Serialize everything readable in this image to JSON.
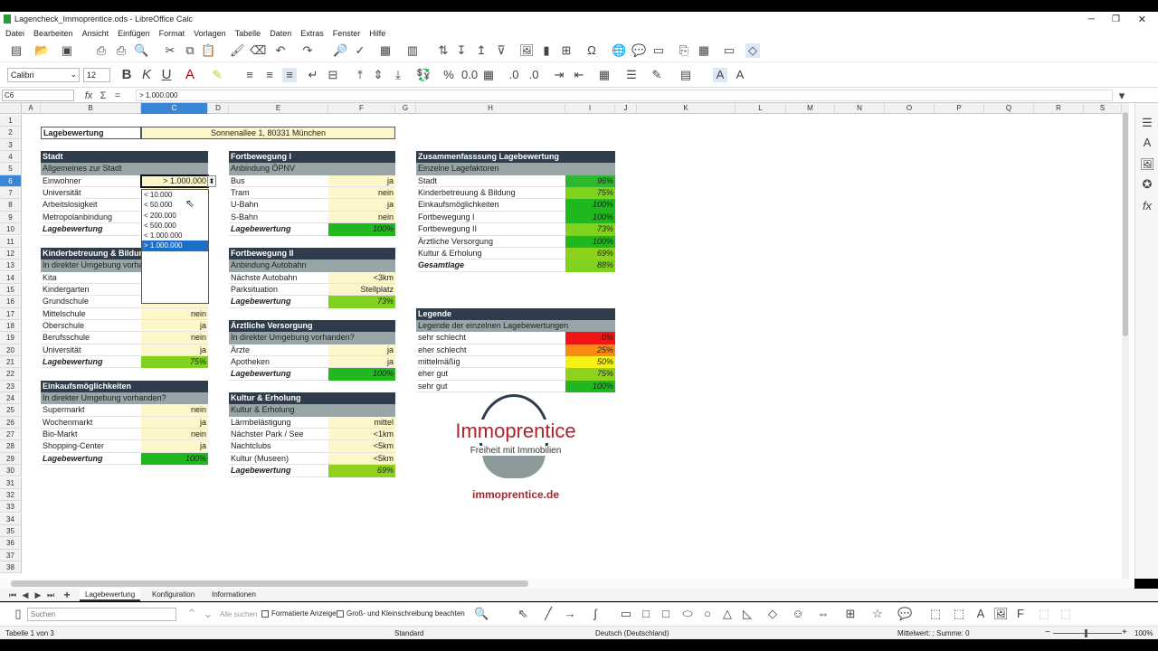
{
  "app": {
    "title": "Lagencheck_Immoprentice.ods - LibreOffice Calc"
  },
  "menu": [
    "Datei",
    "Bearbeiten",
    "Ansicht",
    "Einfügen",
    "Format",
    "Vorlagen",
    "Tabelle",
    "Daten",
    "Extras",
    "Fenster",
    "Hilfe"
  ],
  "formatbar": {
    "font": "Calibri",
    "size": "12"
  },
  "formulabar": {
    "cellref": "C6",
    "content": "> 1.000.000"
  },
  "columns": [
    "A",
    "B",
    "C",
    "D",
    "E",
    "F",
    "G",
    "H",
    "I",
    "J",
    "K",
    "L",
    "M",
    "N",
    "O",
    "P",
    "Q",
    "R",
    "S"
  ],
  "rows": [
    "1",
    "2",
    "3",
    "4",
    "5",
    "6",
    "7",
    "8",
    "9",
    "10",
    "11",
    "12",
    "13",
    "14",
    "15",
    "16",
    "17",
    "18",
    "19",
    "20",
    "21",
    "22",
    "23",
    "24",
    "25",
    "26",
    "27",
    "28",
    "29",
    "30",
    "31",
    "32",
    "33",
    "34",
    "35",
    "36",
    "37",
    "38"
  ],
  "sheet": {
    "title_label": "Lagebewertung",
    "address": "Sonnenallee 1, 80331 München",
    "stadt": {
      "header": "Stadt",
      "sub": "Allgemeines zur Stadt",
      "rows": [
        [
          "Einwohner",
          "> 1.000.000"
        ],
        [
          "Universität",
          ""
        ],
        [
          "Arbeitslosigkeit",
          ""
        ],
        [
          "Metropolanbindung",
          ""
        ]
      ],
      "total_label": "Lagebewertung"
    },
    "kinder": {
      "header": "Kinderbetreuung & Bildung",
      "sub": "In direkter Umgebung vorhanden?",
      "rows": [
        [
          "Kita",
          ""
        ],
        [
          "Kindergarten",
          ""
        ],
        [
          "Grundschule",
          ""
        ],
        [
          "Mittelschule",
          "nein"
        ],
        [
          "Oberschule",
          "ja"
        ],
        [
          "Berufsschule",
          "nein"
        ],
        [
          "Universität",
          "ja"
        ]
      ],
      "total_label": "Lagebewertung",
      "total": "75%"
    },
    "einkauf": {
      "header": "Einkaufsmöglichkeiten",
      "sub": "In direkter Umgebung vorhanden?",
      "rows": [
        [
          "Supermarkt",
          "nein"
        ],
        [
          "Wochenmarkt",
          "ja"
        ],
        [
          "Bio-Markt",
          "nein"
        ],
        [
          "Shopping-Center",
          "ja"
        ]
      ],
      "total_label": "Lagebewertung",
      "total": "100%"
    },
    "fort1": {
      "header": "Fortbewegung I",
      "sub": "Anbindung ÖPNV",
      "rows": [
        [
          "Bus",
          "ja"
        ],
        [
          "Tram",
          "nein"
        ],
        [
          "U-Bahn",
          "ja"
        ],
        [
          "S-Bahn",
          "nein"
        ]
      ],
      "total_label": "Lagebewertung",
      "total": "100%"
    },
    "fort2": {
      "header": "Fortbewegung II",
      "sub": "Anbindung Autobahn",
      "rows": [
        [
          "Nächste Autobahn",
          "<3km"
        ],
        [
          "Parksituation",
          "Stellplatz"
        ]
      ],
      "total_label": "Lagebewertung",
      "total": "73%"
    },
    "arzt": {
      "header": "Ärztliche Versorgung",
      "sub": "In direkter Umgebung vorhanden?",
      "rows": [
        [
          "Ärzte",
          "ja"
        ],
        [
          "Apotheken",
          "ja"
        ]
      ],
      "total_label": "Lagebewertung",
      "total": "100%"
    },
    "kultur": {
      "header": "Kultur & Erholung",
      "sub": "Kultur & Erholung",
      "rows": [
        [
          "Lärmbelästigung",
          "mittel"
        ],
        [
          "Nächster Park / See",
          "<1km"
        ],
        [
          "Nachtclubs",
          "<5km"
        ],
        [
          "Kultur (Museen)",
          "<5km"
        ]
      ],
      "total_label": "Lagebewertung",
      "total": "69%"
    },
    "zusammen": {
      "header": "Zusammenfasssung Lagebewertung",
      "sub": "Einzelne Lagefaktoren",
      "rows": [
        [
          "Stadt",
          "96%",
          "#2db82d"
        ],
        [
          "Kinderbetreuung & Bildung",
          "75%",
          "#7fd21e"
        ],
        [
          "Einkaufsmöglichkeiten",
          "100%",
          "#1fb81f"
        ],
        [
          "Fortbewegung I",
          "100%",
          "#1fb81f"
        ],
        [
          "Fortbewegung II",
          "73%",
          "#7fd21e"
        ],
        [
          "Ärztliche Versorgung",
          "100%",
          "#1fb81f"
        ],
        [
          "Kultur & Erholung",
          "69%",
          "#8fd21e"
        ]
      ],
      "total_label": "Gesamtlage",
      "total": "88%"
    },
    "legende": {
      "header": "Legende",
      "sub": "Legende der einzelnen Lagebewertungen",
      "rows": [
        [
          "sehr schlecht",
          "0%",
          "#f01414"
        ],
        [
          "eher schlecht",
          "25%",
          "#f78b14"
        ],
        [
          "mittelmäßig",
          "50%",
          "#f6f014"
        ],
        [
          "eher gut",
          "75%",
          "#8fd21e"
        ],
        [
          "sehr gut",
          "100%",
          "#1fb81f"
        ]
      ]
    },
    "logo": {
      "name": "Immoprentice",
      "tagline": "Freiheit mit Immobilien",
      "url": "immoprentice.de"
    }
  },
  "dropdown": {
    "options": [
      "< 10.000",
      "< 50.000",
      "< 200.000",
      "< 500.000",
      "< 1.000.000",
      "> 1.000.000"
    ],
    "selected": 5
  },
  "tabs": [
    "Lagebewertung",
    "Konfiguration",
    "Informationen"
  ],
  "find": {
    "placeholder": "Suchen",
    "find_all": "Alle suchen",
    "formatted": "Formatierte Anzeige",
    "case": "Groß- und Kleinschreibung beachten"
  },
  "status": {
    "sheet": "Tabelle 1 von 3",
    "style": "Standard",
    "lang": "Deutsch (Deutschland)",
    "sum": "Mittelwert: ; Summe: 0",
    "zoom": "100%"
  },
  "colors": {
    "header": "#2f3c4c",
    "sub": "#97a5a6",
    "input": "#fcf6c9",
    "logo_red": "#b0222b"
  }
}
